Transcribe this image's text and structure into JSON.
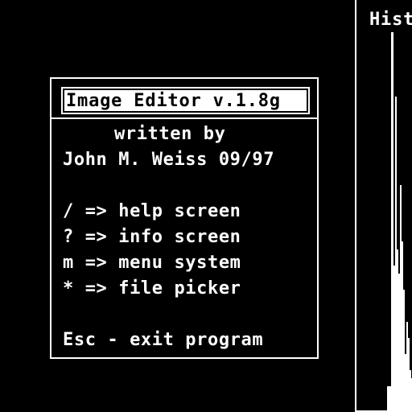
{
  "dialog": {
    "title": "Image Editor v.1.8g",
    "credit_line1": "written by",
    "credit_line2": "John M. Weiss 09/97",
    "shortcuts": [
      "/ => help screen",
      "? => info screen",
      "m => menu system",
      "* => file picker"
    ],
    "exit_line": "Esc - exit program"
  },
  "histogram": {
    "title": "Hist"
  },
  "colors": {
    "background": "#000000",
    "foreground": "#ffffff"
  }
}
